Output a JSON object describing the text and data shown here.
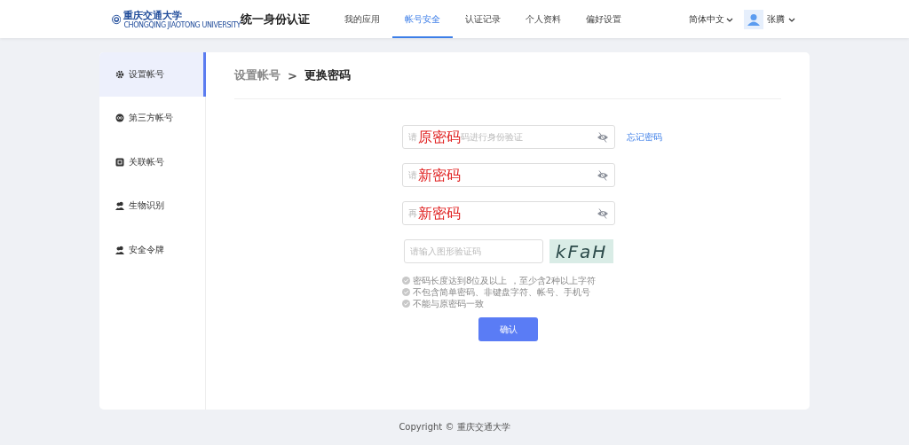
{
  "header": {
    "logo_text": "重庆交通大学",
    "logo_subtext": "CHONGQING JIAOTONG UNIVERSITY",
    "title": "统一身份认证",
    "nav": [
      {
        "label": "我的应用",
        "selected": false
      },
      {
        "label": "帐号安全",
        "selected": true
      },
      {
        "label": "认证记录",
        "selected": false
      },
      {
        "label": "个人资料",
        "selected": false
      },
      {
        "label": "偏好设置",
        "selected": false
      }
    ],
    "language": "简体中文",
    "user": "张腾"
  },
  "sidebar": {
    "items": [
      {
        "label": "设置帐号",
        "selected": true
      },
      {
        "label": "第三方帐号",
        "selected": false
      },
      {
        "label": "关联帐号",
        "selected": false
      },
      {
        "label": "生物识别",
        "selected": false
      },
      {
        "label": "安全令牌",
        "selected": false
      }
    ]
  },
  "breadcrumb": {
    "parent": "设置帐号",
    "separator": ">",
    "current": "更换密码"
  },
  "form": {
    "fields": [
      {
        "kind": "password",
        "hint_start": "请",
        "hint_end": "码进行身份验证",
        "annotation": "原密码",
        "link": "忘记密码"
      },
      {
        "kind": "password",
        "hint_start": "请",
        "annotation": "新密码"
      },
      {
        "kind": "password",
        "hint_start": "再",
        "annotation": "新密码"
      },
      {
        "kind": "captcha",
        "placeholder": "请输入图形验证码",
        "captcha_text": "kFaH"
      }
    ],
    "rules": [
      "密码长度达到8位及以上 ，至少含2种以上字符",
      "不包含简单密码、非键盘字符、帐号、手机号",
      "不能与原密码一致"
    ],
    "submit": "确认"
  },
  "footer": "Copyright © 重庆交通大学"
}
